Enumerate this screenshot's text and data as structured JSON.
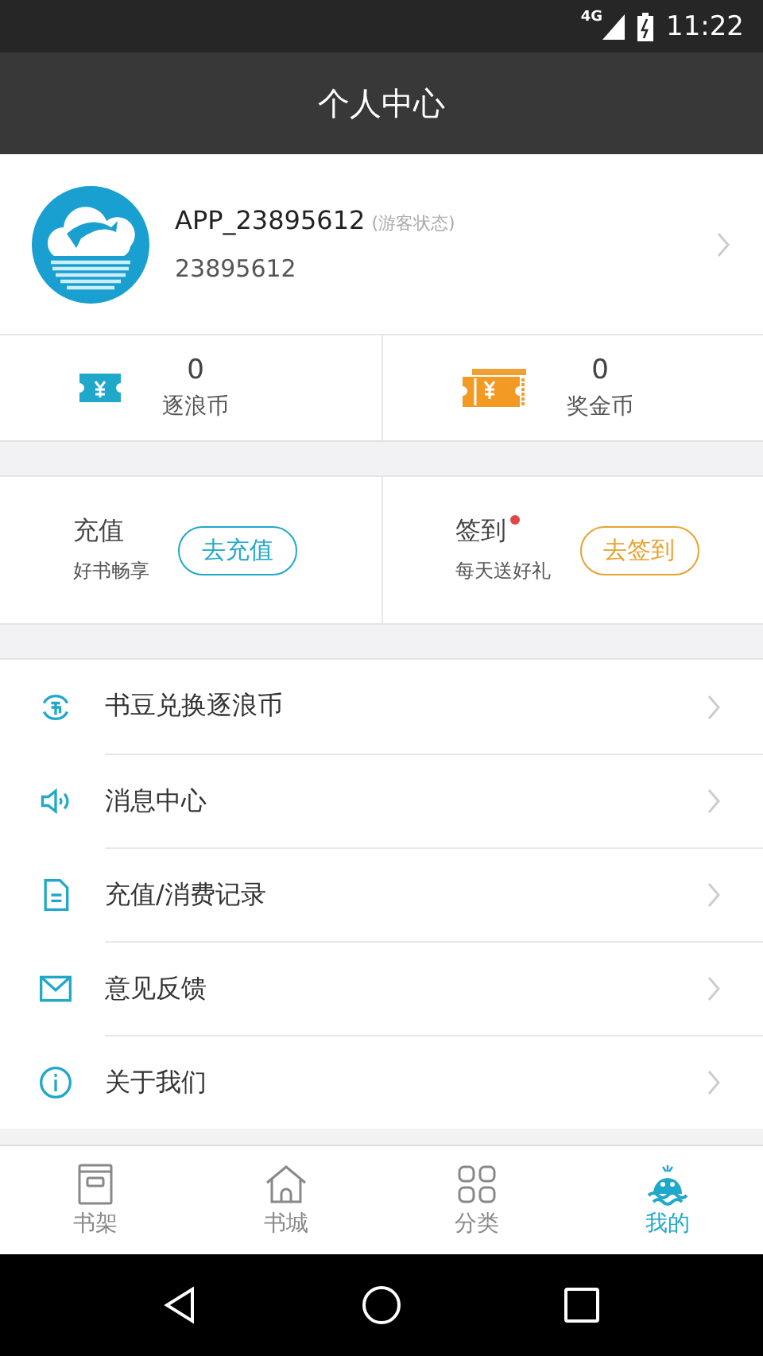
{
  "status_bar": {
    "network": "4G",
    "time": "11:22"
  },
  "title_bar": {
    "title": "个人中心"
  },
  "profile": {
    "username": "APP_23895612",
    "status": "(游客状态)",
    "user_id": "23895612"
  },
  "wallet": [
    {
      "kind": "ticket",
      "count": "0",
      "label": "逐浪币"
    },
    {
      "kind": "tickets",
      "count": "0",
      "label": "奖金币"
    }
  ],
  "actions": [
    {
      "title": "充值",
      "subtitle": "好书畅享",
      "button": "去充值",
      "color": "#1fa8c9",
      "badge": false
    },
    {
      "title": "签到",
      "subtitle": "每天送好礼",
      "button": "去签到",
      "color": "#e8a22e",
      "badge": true
    }
  ],
  "menu": [
    {
      "kind": "exchange",
      "label": "书豆兑换逐浪币"
    },
    {
      "kind": "speaker",
      "label": "消息中心"
    },
    {
      "kind": "document",
      "label": "充值/消费记录"
    },
    {
      "kind": "mail",
      "label": "意见反馈"
    },
    {
      "kind": "info",
      "label": "关于我们"
    }
  ],
  "tab_bar": [
    {
      "kind": "shelf",
      "label": "书架",
      "selected": false
    },
    {
      "kind": "store",
      "label": "书城",
      "selected": false
    },
    {
      "kind": "grid",
      "label": "分类",
      "selected": false
    },
    {
      "kind": "mascot",
      "label": "我的",
      "selected": true
    }
  ]
}
